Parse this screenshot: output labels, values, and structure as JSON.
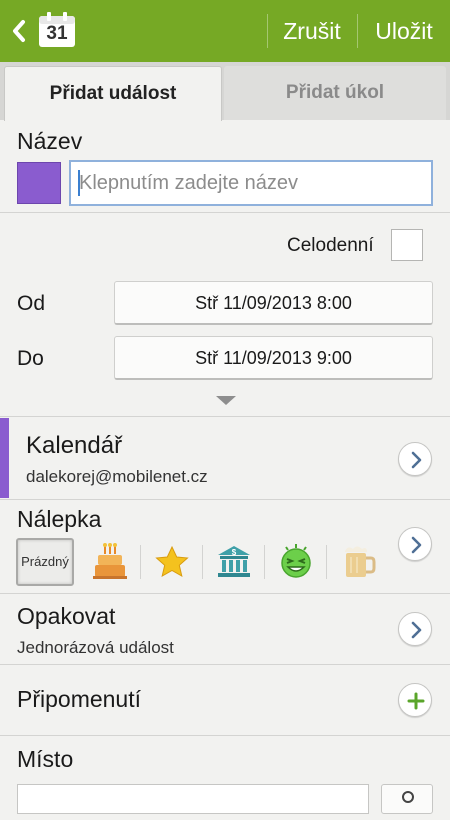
{
  "header": {
    "calendar_day": "31",
    "cancel_label": "Zrušit",
    "save_label": "Uložit",
    "accent_color": "#76a925"
  },
  "tabs": [
    {
      "label": "Přidat událost",
      "active": true
    },
    {
      "label": "Přidat úkol",
      "active": false
    }
  ],
  "title_section": {
    "label": "Název",
    "placeholder": "Klepnutím zadejte název",
    "color": "#8a5ccf"
  },
  "allday": {
    "label": "Celodenní",
    "checked": false
  },
  "from": {
    "label": "Od",
    "value": "Stř 11/09/2013  8:00"
  },
  "to": {
    "label": "Do",
    "value": "Stř 11/09/2013  9:00"
  },
  "calendar": {
    "label": "Kalendář",
    "account": "dalekorej@mobilenet.cz"
  },
  "sticker": {
    "label": "Nálepka",
    "empty_label": "Prázdný",
    "icons": [
      "cake-icon",
      "star-icon",
      "bank-icon",
      "smiley-icon",
      "beer-icon"
    ]
  },
  "repeat": {
    "label": "Opakovat",
    "value": "Jednorázová událost"
  },
  "reminder": {
    "label": "Připomenutí"
  },
  "location": {
    "label": "Místo"
  }
}
